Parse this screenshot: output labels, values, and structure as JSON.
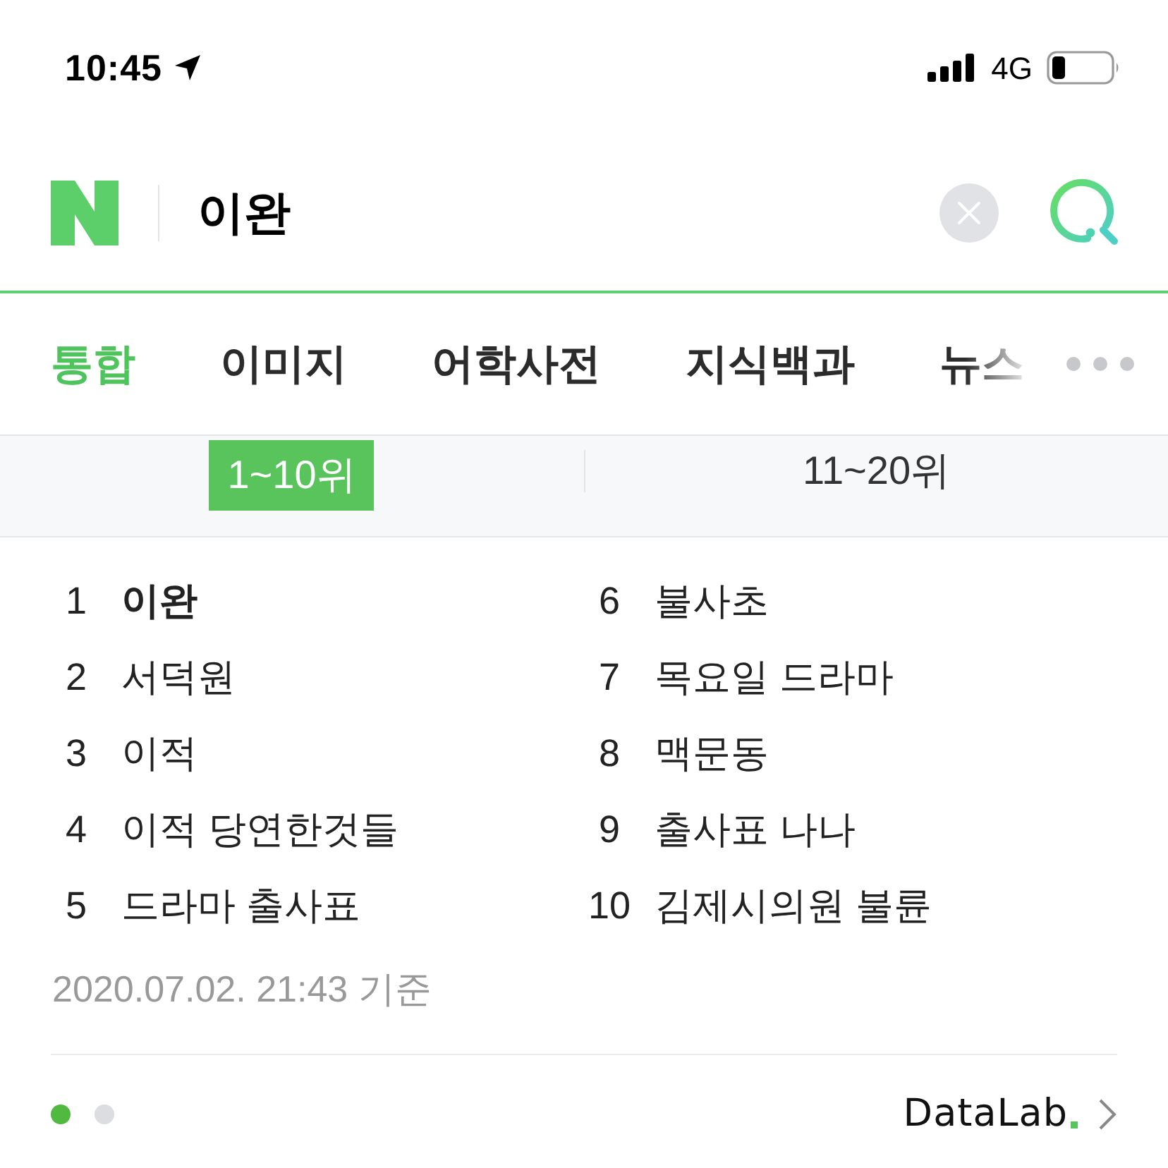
{
  "status_bar": {
    "time": "10:45",
    "network": "4G"
  },
  "search": {
    "query": "이완"
  },
  "tabs": [
    {
      "label": "통합",
      "selected": true,
      "faded": false
    },
    {
      "label": "이미지",
      "selected": false,
      "faded": false
    },
    {
      "label": "어학사전",
      "selected": false,
      "faded": false
    },
    {
      "label": "지식백과",
      "selected": false,
      "faded": false
    },
    {
      "label": "뉴스",
      "selected": false,
      "faded": true
    }
  ],
  "rank_tabs": [
    {
      "label": "1~10위",
      "selected": true
    },
    {
      "label": "11~20위",
      "selected": false
    }
  ],
  "rankings": [
    {
      "rank": "1",
      "keyword": "이완",
      "highlighted": true
    },
    {
      "rank": "2",
      "keyword": "서덕원",
      "highlighted": false
    },
    {
      "rank": "3",
      "keyword": "이적",
      "highlighted": false
    },
    {
      "rank": "4",
      "keyword": "이적 당연한것들",
      "highlighted": false
    },
    {
      "rank": "5",
      "keyword": "드라마 출사표",
      "highlighted": false
    },
    {
      "rank": "6",
      "keyword": "불사초",
      "highlighted": false
    },
    {
      "rank": "7",
      "keyword": "목요일 드라마",
      "highlighted": false
    },
    {
      "rank": "8",
      "keyword": "맥문동",
      "highlighted": false
    },
    {
      "rank": "9",
      "keyword": "출사표 나나",
      "highlighted": false
    },
    {
      "rank": "10",
      "keyword": "김제시의원 불륜",
      "highlighted": false
    }
  ],
  "timestamp": "2020.07.02. 21:43 기준",
  "pages": [
    {
      "selected": true
    },
    {
      "selected": false
    }
  ],
  "footer": {
    "link": "DataLab"
  }
}
